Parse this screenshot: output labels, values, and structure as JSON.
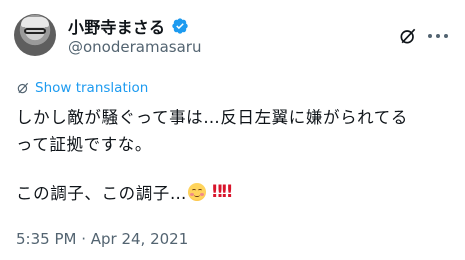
{
  "author": {
    "display_name": "小野寺まさる",
    "handle": "@onoderamasaru",
    "verified": true,
    "verified_color": "#1d9bf0"
  },
  "translate": {
    "label": "Show translation",
    "icon": "translate-icon",
    "color": "#1d9bf0"
  },
  "tweet": {
    "line1": "しかし敵が騒ぐって事は…反日左翼に嫌がられてる",
    "line2": "って証拠ですな。",
    "line3": "この調子、この調子…",
    "emoji": "smiling-face-with-smiling-eyes",
    "exclamations": "‼‼"
  },
  "meta": {
    "timestamp": "5:35 PM · Apr 24, 2021"
  },
  "icons": {
    "grok": "grok-icon",
    "more": "more-options-icon"
  }
}
